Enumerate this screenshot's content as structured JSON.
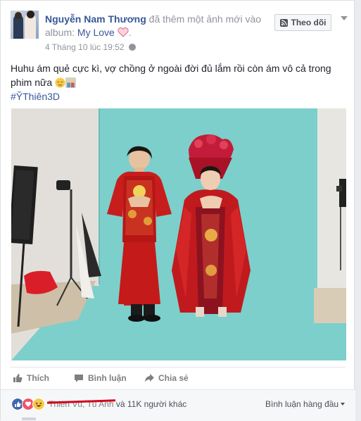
{
  "post": {
    "author": "Nguyễn Nam Thương",
    "action_text": " đã thêm một ảnh mới vào album: ",
    "album_name": "My Love",
    "album_suffix": ".",
    "timestamp": "4 Tháng 10 lúc 19:52",
    "follow_label": "Theo dõi",
    "text_line": "Huhu ám quẻ cực kì, vợ chồng ở ngoài đời đủ lắm rồi còn ám vô cả trong phim nữa",
    "hashtag": "#ỸThiên3D"
  },
  "actions": {
    "like": "Thích",
    "comment": "Bình luận",
    "share": "Chia sẻ"
  },
  "footer": {
    "names_struck": "Thiên Vũ, Tú Anh",
    "others": " và 11K người khác",
    "top_comments": "Bình luận hàng đầu"
  },
  "colors": {
    "link": "#365899",
    "text": "#1d2129",
    "muted": "#90949c",
    "backdrop": "#7ccfca",
    "dress_red": "#c41a1a"
  },
  "icons": {
    "heart": "pink-heart",
    "emoji1": "relieved-face",
    "emoji2": "couple-emoji",
    "like": "thumbs-up",
    "comment": "speech-bubble",
    "share": "share-arrow",
    "follow": "rss"
  }
}
